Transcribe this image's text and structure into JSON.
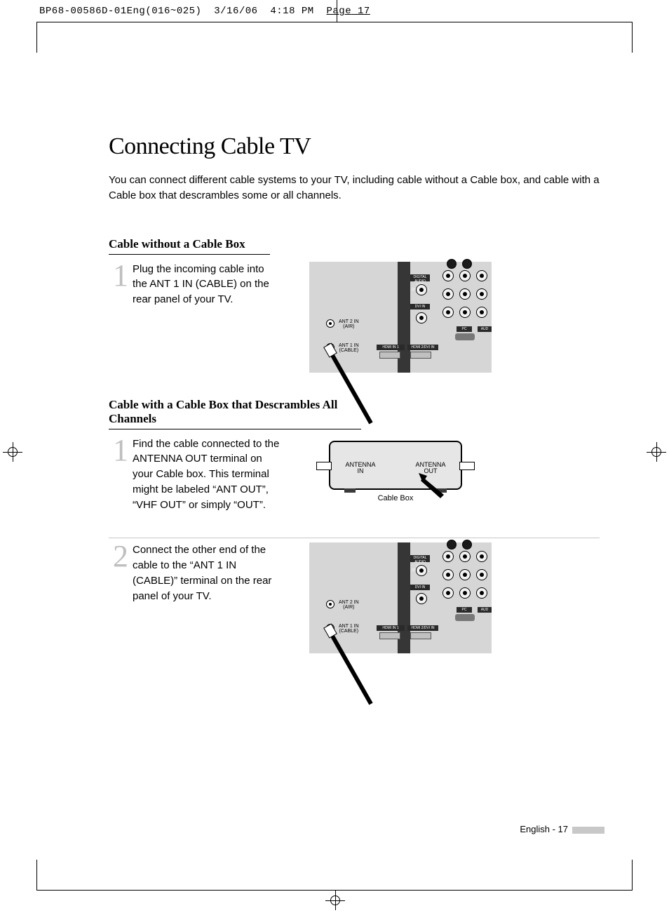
{
  "cropmark": {
    "filename": "BP68-00586D-01Eng(016~025)",
    "date": "3/16/06",
    "time": "4:18 PM",
    "pagelabel": "Page",
    "pagenum": "17"
  },
  "title": "Connecting Cable TV",
  "intro": "You can connect different cable systems to your TV, including cable without a Cable box, and cable with a Cable box that descrambles some or all channels.",
  "section1": {
    "heading": "Cable without a Cable Box",
    "step1_num": "1",
    "step1_text": "Plug the incoming cable into the ANT 1 IN (CABLE) on the rear panel of your TV."
  },
  "section2": {
    "heading": "Cable with a Cable Box that Descrambles All Channels",
    "step1_num": "1",
    "step1_text": "Find the cable connected to the ANTENNA OUT terminal on your Cable box. This terminal might be labeled “ANT OUT”, “VHF OUT” or simply “OUT”.",
    "step2_num": "2",
    "step2_text": "Connect the other end of the cable to the “ANT 1 IN (CABLE)” terminal on the rear panel of your TV."
  },
  "panel_labels": {
    "ant2": "ANT 2 IN\n(AIR)",
    "ant1": "ANT 1 IN\n(CABLE)",
    "optical": "DIGITAL AUDIO\nOUT (OPTICAL)",
    "dvi": "DVI IN",
    "pc": "PC",
    "aud": "AUD",
    "hdmi1": "HDMI IN 1",
    "hdmi2": "HDMI 2/DVI IN"
  },
  "cablebox": {
    "antenna_in": "ANTENNA\nIN",
    "antenna_out": "ANTENNA\nOUT",
    "caption": "Cable Box"
  },
  "footer": "English - 17"
}
